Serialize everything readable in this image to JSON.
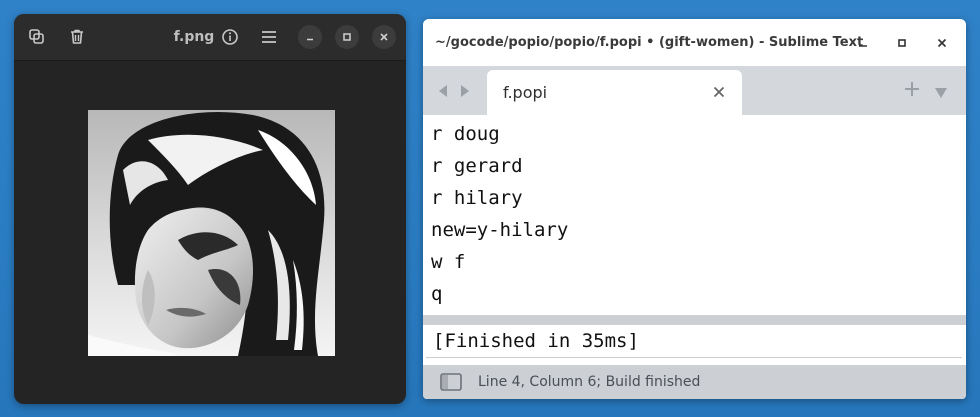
{
  "image_viewer": {
    "title": "f.png",
    "icons": {
      "copy": "copy-icon",
      "delete": "trash-icon",
      "info": "info-icon",
      "menu": "hamburger-menu-icon",
      "minimize": "minimize-icon",
      "maximize": "maximize-icon",
      "close": "close-icon"
    },
    "colors": {
      "background": "#242424",
      "header": "#2c2c2c"
    }
  },
  "sublime": {
    "window_title": "~/gocode/popio/popio/f.popi • (gift-women) - Sublime Text",
    "tab": {
      "label": "f.popi"
    },
    "editor_lines": [
      "r doug",
      "r gerard",
      "r hilary",
      "new=y-hilary",
      "w f",
      "q"
    ],
    "build_output": "[Finished in 35ms]",
    "status": "Line 4, Column 6; Build finished",
    "colors": {
      "tabbar": "#d4d7db",
      "statusbar": "#ccd0d5"
    }
  },
  "desktop": {
    "background": "#2a7cc2"
  }
}
